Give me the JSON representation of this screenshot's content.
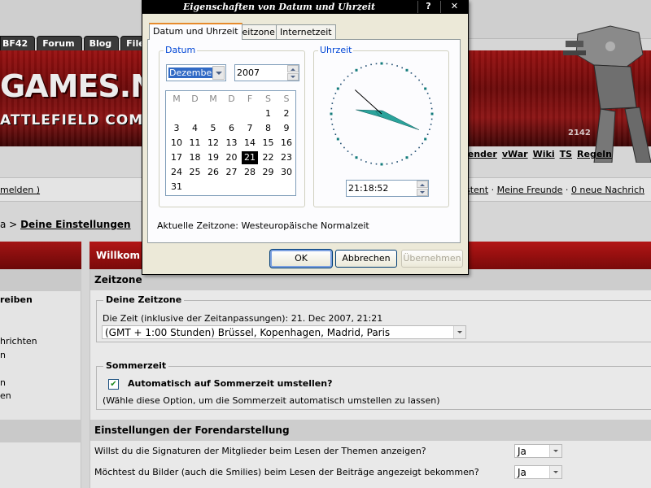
{
  "forum": {
    "nav_tabs": [
      "BF42",
      "Forum",
      "Blog",
      "Files"
    ],
    "brand": "GAMES.NE",
    "brand_sub": "ATTLEFIELD COMMUNIT",
    "banner_badge": "2142",
    "subnav": [
      "lender",
      "vWar",
      "Wiki",
      "TS",
      "Regeln"
    ],
    "user_left": "melden )",
    "user_right_parts": [
      "stent",
      "Meine Freunde",
      "0 neue Nachrich"
    ],
    "breadcrumb_sep": "a >",
    "breadcrumb_current": "Deine Einstellungen",
    "left_items": [
      "reiben",
      "hrichten",
      "n",
      "n",
      "en"
    ],
    "main_heading": "Willkom",
    "section_timezone": "Zeitzone",
    "your_timezone_legend": "Deine Zeitzone",
    "time_text": "Die Zeit (inklusive der Zeitanpassungen): 21. Dec 2007, 21:21",
    "timezone_select": "(GMT + 1:00 Stunden) Brüssel, Kopenhagen, Madrid, Paris",
    "dst_legend": "Sommerzeit",
    "dst_checkbox_label": "Automatisch auf Sommerzeit umstellen?",
    "dst_checked": true,
    "dst_hint": "(Wähle diese Option, um die Sommerzeit automatisch umstellen zu lassen)",
    "section_display": "Einstellungen der Forendarstellung",
    "q_signatures": "Willst du die Signaturen der Mitglieder beim Lesen der Themen anzeigen?",
    "q_signatures_value": "Ja",
    "q_images": "Möchtest du Bilder (auch die Smilies) beim Lesen der Beiträge angezeigt bekommen?",
    "q_images_value": "Ja"
  },
  "dialog": {
    "title": "Eigenschaften von Datum und Uhrzeit",
    "help_label": "?",
    "close_label": "✕",
    "tabs": [
      "Datum und Uhrzeit",
      "Zeitzone",
      "Internetzeit"
    ],
    "date_group": "Datum",
    "month": "Dezember",
    "year": "2007",
    "weekday_headers": [
      "M",
      "D",
      "M",
      "D",
      "F",
      "S",
      "S"
    ],
    "calendar_weeks": [
      [
        "",
        "",
        "",
        "",
        "",
        "1",
        "2"
      ],
      [
        "3",
        "4",
        "5",
        "6",
        "7",
        "8",
        "9"
      ],
      [
        "10",
        "11",
        "12",
        "13",
        "14",
        "15",
        "16"
      ],
      [
        "17",
        "18",
        "19",
        "20",
        "21",
        "22",
        "23"
      ],
      [
        "24",
        "25",
        "26",
        "27",
        "28",
        "29",
        "30"
      ],
      [
        "31",
        "",
        "",
        "",
        "",
        "",
        ""
      ]
    ],
    "selected_day": "21",
    "time_group": "Uhrzeit",
    "time_value": "21:18:52",
    "clock_time": {
      "hours": 21,
      "minutes": 18,
      "seconds": 52
    },
    "current_timezone": "Aktuelle Zeitzone: Westeuropäische Normalzeit",
    "ok_label": "OK",
    "cancel_label": "Abbrechen",
    "apply_label": "Übernehmen"
  }
}
